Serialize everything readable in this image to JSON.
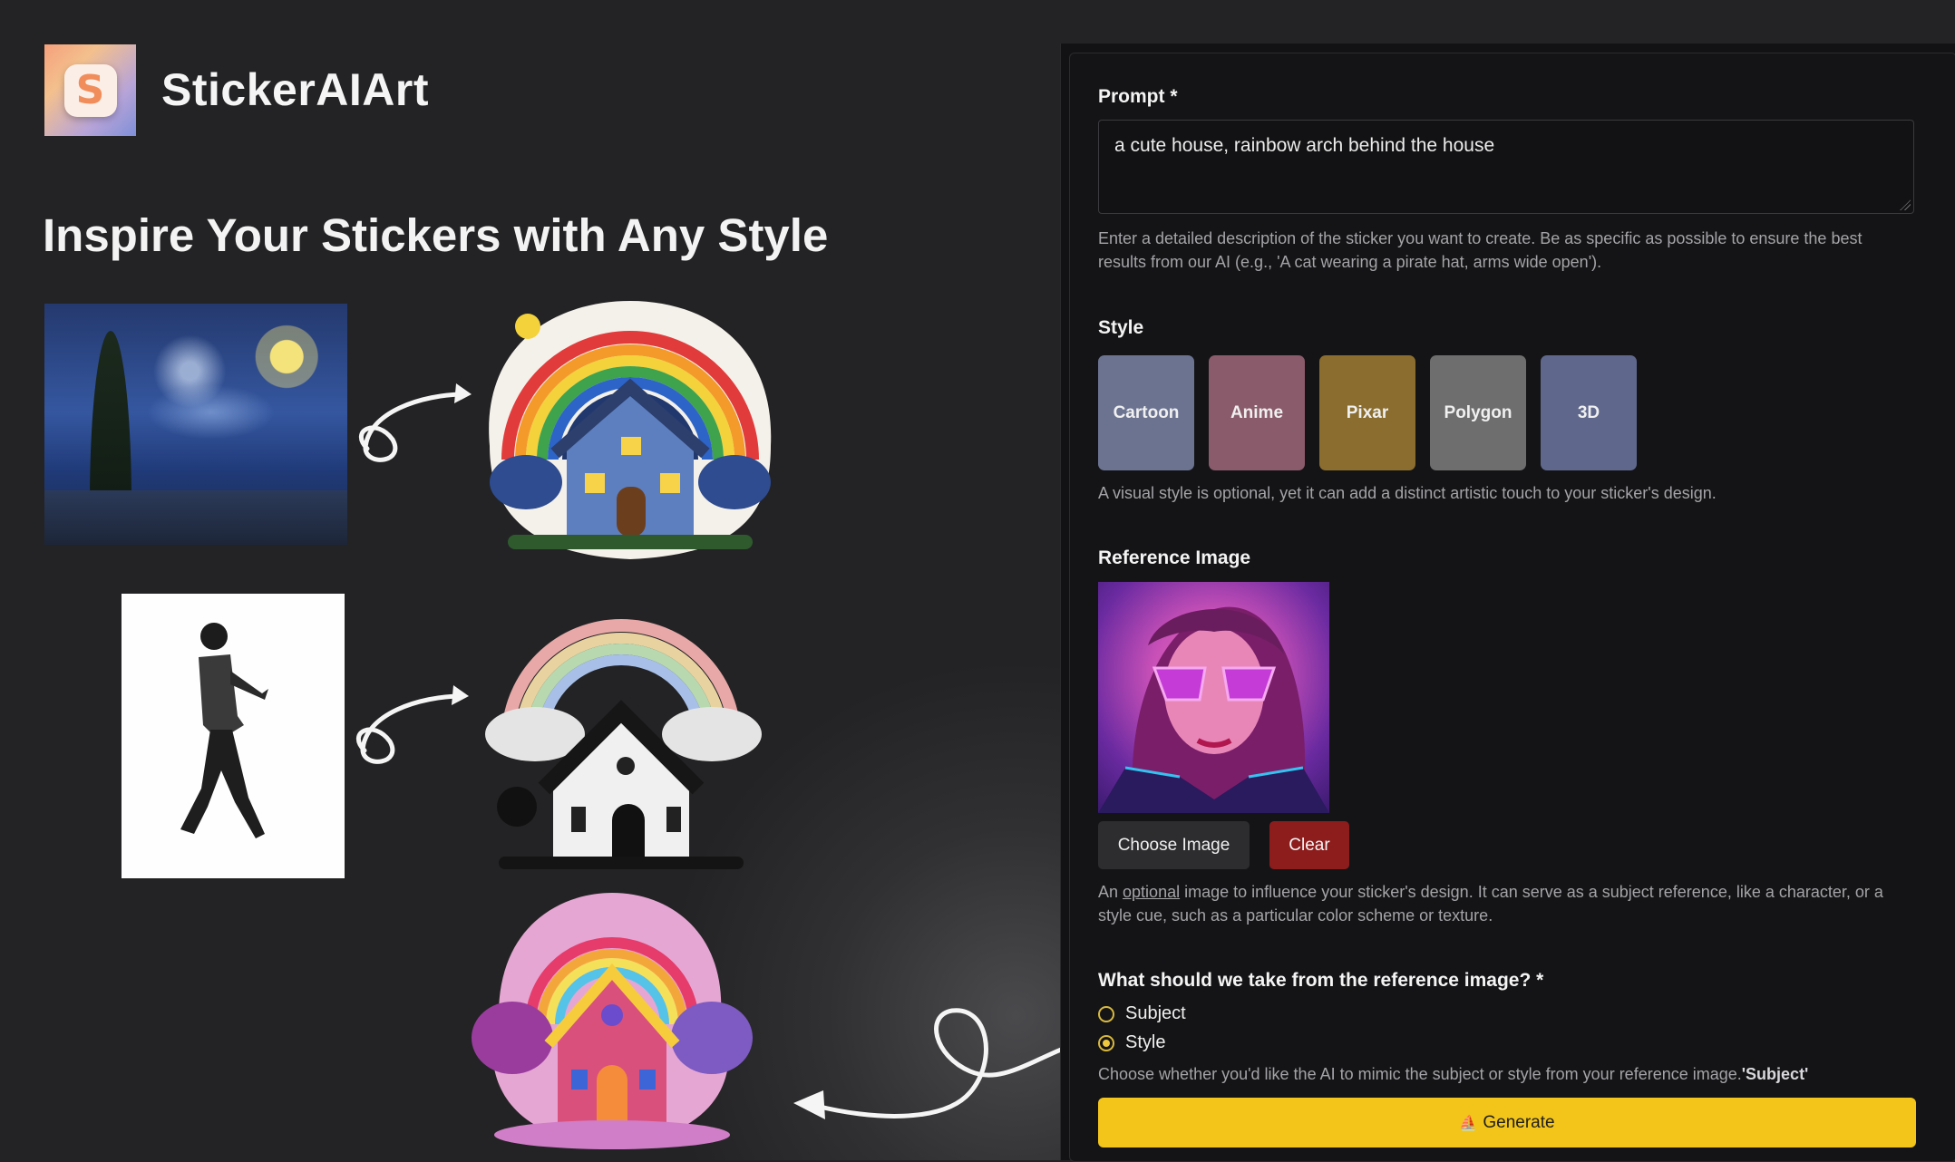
{
  "app": {
    "name": "StickerAIArt",
    "logo_letter": "S"
  },
  "hero": {
    "title": "Inspire Your Stickers with Any Style"
  },
  "form": {
    "prompt": {
      "label": "Prompt *",
      "value": "a cute house, rainbow arch behind the house",
      "help": "Enter a detailed description of the sticker you want to create. Be as specific as possible to ensure the best results from our AI (e.g., 'A cat wearing a pirate hat, arms wide open')."
    },
    "style": {
      "label": "Style",
      "options": [
        {
          "label": "Cartoon",
          "color": "#6b7391"
        },
        {
          "label": "Anime",
          "color": "#8a5b6a"
        },
        {
          "label": "Pixar",
          "color": "#8a6d2f"
        },
        {
          "label": "Polygon",
          "color": "#6e6e6e"
        },
        {
          "label": "3D",
          "color": "#5f688c"
        }
      ],
      "help": "A visual style is optional, yet it can add a distinct artistic touch to your sticker's design."
    },
    "reference": {
      "label": "Reference Image",
      "choose_label": "Choose Image",
      "clear_label": "Clear",
      "help_pre": "An ",
      "help_link": "optional",
      "help_post": " image to influence your sticker's design. It can serve as a subject reference, like a character, or a style cue, such as a particular color scheme or texture."
    },
    "take": {
      "label": "What should we take from the reference image? *",
      "options": [
        {
          "label": "Subject",
          "checked": false
        },
        {
          "label": "Style",
          "checked": true
        }
      ],
      "help_pre": "Choose whether you'd like the AI to mimic the subject or style from your reference image.",
      "help_bold": "'Subject'"
    },
    "generate_label": "Generate",
    "generate_icon": "⛵"
  }
}
